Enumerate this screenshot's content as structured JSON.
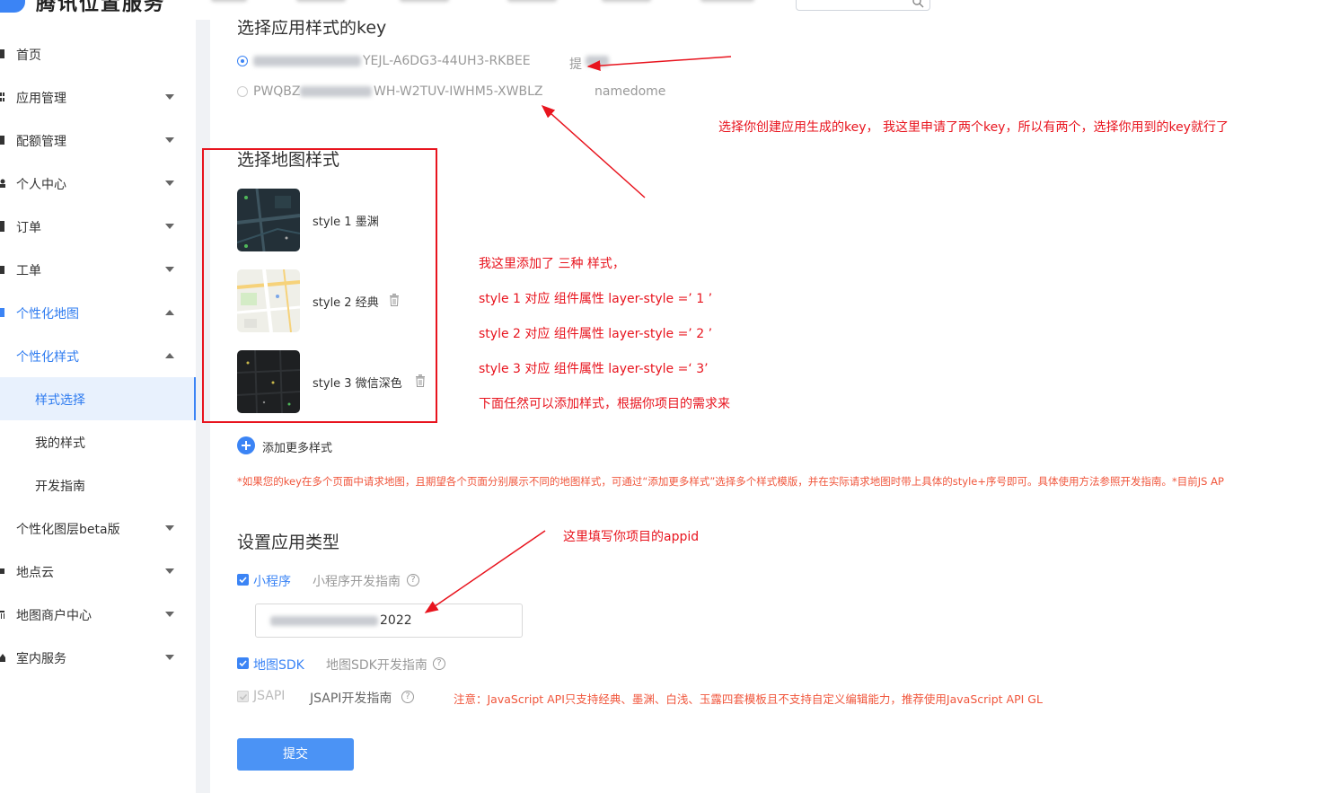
{
  "brand": {
    "name": "腾讯位置服务"
  },
  "sidebar": {
    "items": [
      {
        "label": "首页"
      },
      {
        "label": "应用管理"
      },
      {
        "label": "配额管理"
      },
      {
        "label": "个人中心"
      },
      {
        "label": "订单"
      },
      {
        "label": "工单"
      },
      {
        "label": "个性化地图"
      },
      {
        "label": "个性化样式"
      },
      {
        "label": "样式选择"
      },
      {
        "label": "我的样式"
      },
      {
        "label": "开发指南"
      },
      {
        "label": "个性化图层beta版"
      },
      {
        "label": "地点云"
      },
      {
        "label": "地图商户中心"
      },
      {
        "label": "室内服务"
      }
    ]
  },
  "key_section": {
    "title": "选择应用样式的key",
    "keys": [
      {
        "value_suffix": "YEJL-A6DG3-44UH3-RKBEE",
        "name": "提",
        "selected": true
      },
      {
        "value_prefix": "PWQBZ",
        "value_suffix": "WH-W2TUV-IWHM5-XWBLZ",
        "name": "namedome",
        "selected": false
      }
    ]
  },
  "map_style_section": {
    "title": "选择地图样式",
    "styles": [
      {
        "label": "style 1 墨渊"
      },
      {
        "label": "style 2 经典"
      },
      {
        "label": "style 3 微信深色"
      }
    ],
    "add_more": "添加更多样式",
    "note": "*如果您的key在多个页面中请求地图，且期望各个页面分别展示不同的地图样式，可通过“添加更多样式”选择多个样式模版，并在实际请求地图时带上具体的style+序号即可。具体使用方法参照开发指南。*目前JS AP"
  },
  "app_type_section": {
    "title": "设置应用类型",
    "options": [
      {
        "label": "小程序",
        "guide": "小程序开发指南",
        "checked": true
      },
      {
        "label": "地图SDK",
        "guide": "地图SDK开发指南",
        "checked": true
      },
      {
        "label": "JSAPI",
        "guide": "JSAPI开发指南",
        "checked": true,
        "disabled": true
      }
    ],
    "appid_suffix": "2022",
    "jsapi_note": "注意：JavaScript API只支持经典、墨渊、白浅、玉露四套模板且不支持自定义编辑能力，推荐使用JavaScript API GL",
    "submit": "提交"
  },
  "annotations": {
    "key_note": "选择你创建应用生成的key， 我这里申请了两个key，所以有两个，选择你用到的key就行了",
    "styles_added": "我这里添加了 三种 样式，",
    "style1_map": "style 1    对应 组件属性      layer-style =’ 1 ’",
    "style2_map": "style 2     对应  组件属性     layer-style =’ 2 ’",
    "style3_map": "style 3     对应  组件属性    layer-style =‘ 3’",
    "add_more_note": "下面任然可以添加样式，根据你项目的需求来",
    "appid_note": "这里填写你项目的appid"
  },
  "colors": {
    "accent": "#3b84f5",
    "annotation": "#e8141e",
    "warning": "#f0563c"
  }
}
